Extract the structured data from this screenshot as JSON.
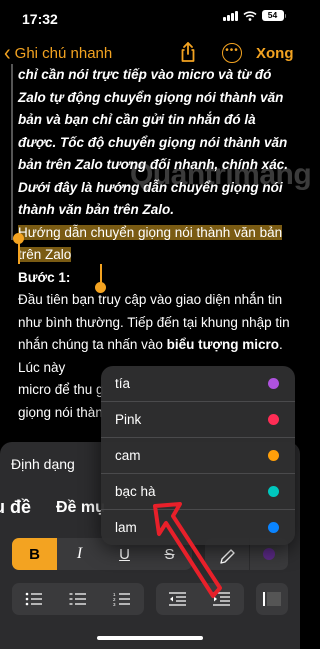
{
  "status": {
    "time": "17:32",
    "battery": "54"
  },
  "nav": {
    "back_label": "Ghi chú nhanh",
    "done_label": "Xong"
  },
  "note": {
    "italic_paragraph": "chỉ cần nói trực tiếp vào micro và từ đó Zalo tự động chuyển giọng nói thành văn bản và bạn chỉ cần gửi tin nhắn đó là được. Tốc độ chuyển giọng nói thành văn bản trên Zalo tương đối nhanh, chính xác. Dưới đây là hướng dẫn chuyển giọng nói thành văn bản trên Zalo.",
    "selected_line": "Hướng dẫn chuyển giọng nói thành văn bản trên Zalo",
    "step_title": "Bước 1:",
    "body_part1": "Đầu tiên bạn truy cập vào giao diện nhắn tin như bình thường. Tiếp đến tại khung nhập tin nhắn chúng ta nhấn vào ",
    "body_bold1": "biểu tượng micro",
    "body_part2": ". Lúc này",
    "body_line2": "micro để thu g",
    "body_line3": "giọng nói thàn"
  },
  "watermark": "Quantrimang",
  "format_panel": {
    "title": "Định dạng",
    "style_heading": "u đề",
    "style_subheading": "Đề mụ",
    "bold": "B",
    "italic": "I",
    "underline": "U",
    "strike": "S"
  },
  "color_menu": {
    "items": [
      {
        "label": "tía",
        "color": "#af52de"
      },
      {
        "label": "Pink",
        "color": "#ff2d55"
      },
      {
        "label": "cam",
        "color": "#ff9f0a"
      },
      {
        "label": "bạc hà",
        "color": "#00c7be"
      },
      {
        "label": "lam",
        "color": "#0a84ff"
      }
    ]
  },
  "colors": {
    "accent": "#f3a321",
    "annotation": "#e8202a"
  }
}
